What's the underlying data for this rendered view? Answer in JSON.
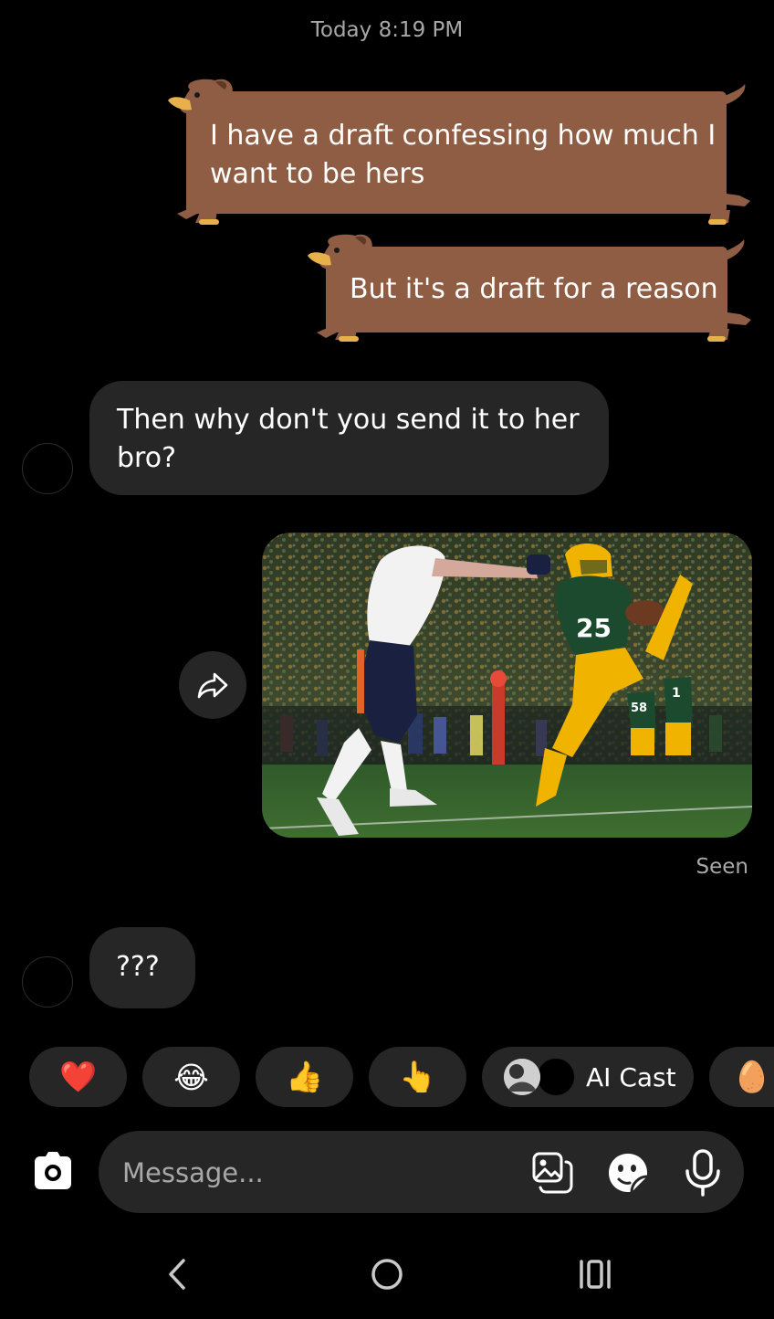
{
  "thread": {
    "timestamp": "Today 8:19 PM",
    "messages": [
      {
        "from": "me",
        "text": "I have a draft confessing how much I want to be hers"
      },
      {
        "from": "me",
        "text": "But it's a draft for a reason"
      },
      {
        "from": "them",
        "text": "Then why don't you send it to her bro?"
      },
      {
        "from": "me",
        "type": "photo",
        "photo_jerseys": [
          "25",
          "58",
          "1"
        ]
      },
      {
        "from": "them",
        "text": "???"
      }
    ],
    "seen_label": "Seen"
  },
  "quick_reactions": [
    {
      "emoji": "❤️",
      "icon": "heart-icon"
    },
    {
      "emoji": "😂",
      "icon": "laughing-emoji-icon"
    },
    {
      "emoji": "👍",
      "icon": "thumbs-up-icon"
    },
    {
      "emoji": "👆",
      "icon": "pointing-hand-icon"
    },
    {
      "label": "AI Cast",
      "icon": "ai-cast-avatars"
    },
    {
      "emoji": "🥚",
      "icon": "egg-icon"
    }
  ],
  "composer": {
    "placeholder": "Message...",
    "icons": [
      "camera-icon",
      "gallery-icon",
      "sticker-icon",
      "microphone-icon"
    ]
  },
  "nav": {
    "icons": [
      "back-icon",
      "home-icon",
      "recents-icon"
    ]
  },
  "colors": {
    "background": "#000000",
    "bubble_sent": "#8e5d43",
    "bubble_received": "#262626",
    "muted_text": "#a8a8a8"
  }
}
